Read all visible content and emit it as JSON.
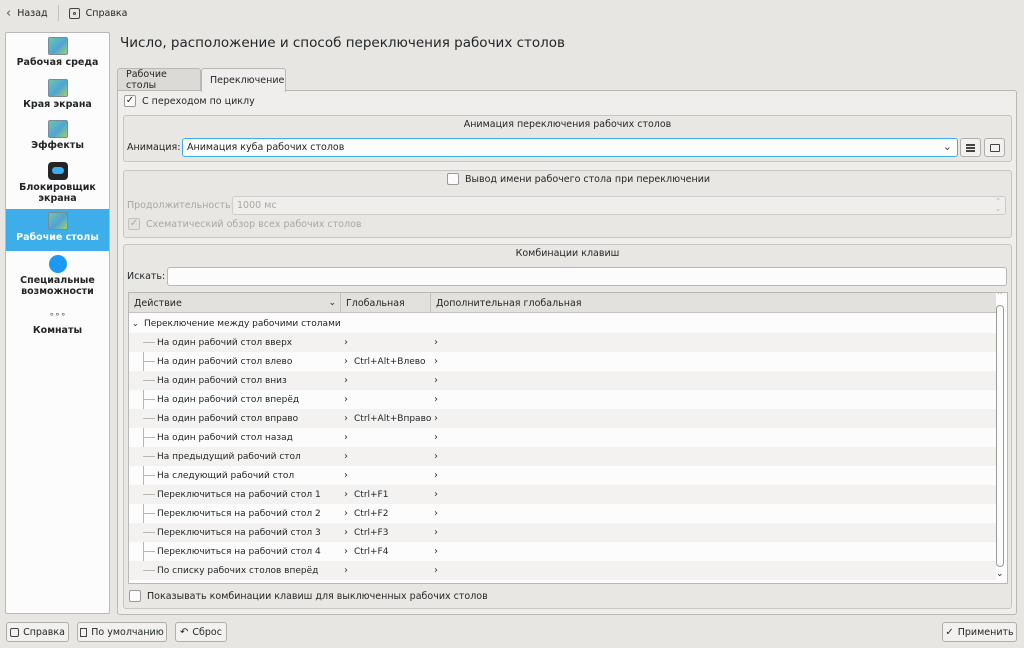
{
  "toolbar": {
    "back_label": "Назад",
    "help_label": "Справка"
  },
  "sidebar": {
    "items": [
      {
        "label": "Рабочая среда"
      },
      {
        "label": "Края экрана"
      },
      {
        "label": "Эффекты"
      },
      {
        "label": "Блокировщик экрана"
      },
      {
        "label": "Рабочие столы"
      },
      {
        "label": "Специальные возможности"
      },
      {
        "label": "Комнаты"
      }
    ],
    "rooms_icon_text": "∘∘∘"
  },
  "page": {
    "title": "Число, расположение и способ переключения рабочих столов"
  },
  "tabs": [
    {
      "label": "Рабочие столы"
    },
    {
      "label": "Переключение"
    }
  ],
  "switching": {
    "wrap_label": "С переходом по циклу",
    "wrap_checked": true,
    "animation_group_title": "Анимация переключения рабочих столов",
    "animation_label": "Анимация:",
    "animation_value": "Анимация куба рабочих столов",
    "osd_label": "Вывод имени рабочего стола при переключении",
    "osd_checked": false,
    "duration_label": "Продолжительность:",
    "duration_value": "1000 мс",
    "schematic_label": "Схематический обзор всех рабочих столов",
    "shortcuts_group_title": "Комбинации клавиш",
    "search_label": "Искать:",
    "search_value": "",
    "show_disabled_label": "Показывать комбинации клавиш для выключенных рабочих столов"
  },
  "table": {
    "columns": [
      "Действие",
      "Глобальная",
      "Дополнительная глобальная"
    ],
    "group_label": "Переключение между рабочими столами",
    "rows": [
      {
        "action": "На один рабочий стол вверх",
        "global": "",
        "alt": ""
      },
      {
        "action": "На один рабочий стол влево",
        "global": "Ctrl+Alt+Влево",
        "alt": ""
      },
      {
        "action": "На один рабочий стол вниз",
        "global": "",
        "alt": ""
      },
      {
        "action": "На один рабочий стол вперёд",
        "global": "",
        "alt": ""
      },
      {
        "action": "На один рабочий стол вправо",
        "global": "Ctrl+Alt+Вправо",
        "alt": ""
      },
      {
        "action": "На один рабочий стол назад",
        "global": "",
        "alt": ""
      },
      {
        "action": "На предыдущий рабочий стол",
        "global": "",
        "alt": ""
      },
      {
        "action": "На следующий рабочий стол",
        "global": "",
        "alt": ""
      },
      {
        "action": "Переключиться на рабочий стол 1",
        "global": "Ctrl+F1",
        "alt": ""
      },
      {
        "action": "Переключиться на рабочий стол 2",
        "global": "Ctrl+F2",
        "alt": ""
      },
      {
        "action": "Переключиться на рабочий стол 3",
        "global": "Ctrl+F3",
        "alt": ""
      },
      {
        "action": "Переключиться на рабочий стол 4",
        "global": "Ctrl+F4",
        "alt": ""
      },
      {
        "action": "По списку рабочих столов вперёд",
        "global": "",
        "alt": ""
      }
    ]
  },
  "footer": {
    "help_label": "Справка",
    "defaults_label": "По умолчанию",
    "reset_label": "Сброс",
    "apply_label": "Применить"
  },
  "colors": {
    "accent": "#3daee9",
    "window_bg": "#e8e6e3"
  }
}
